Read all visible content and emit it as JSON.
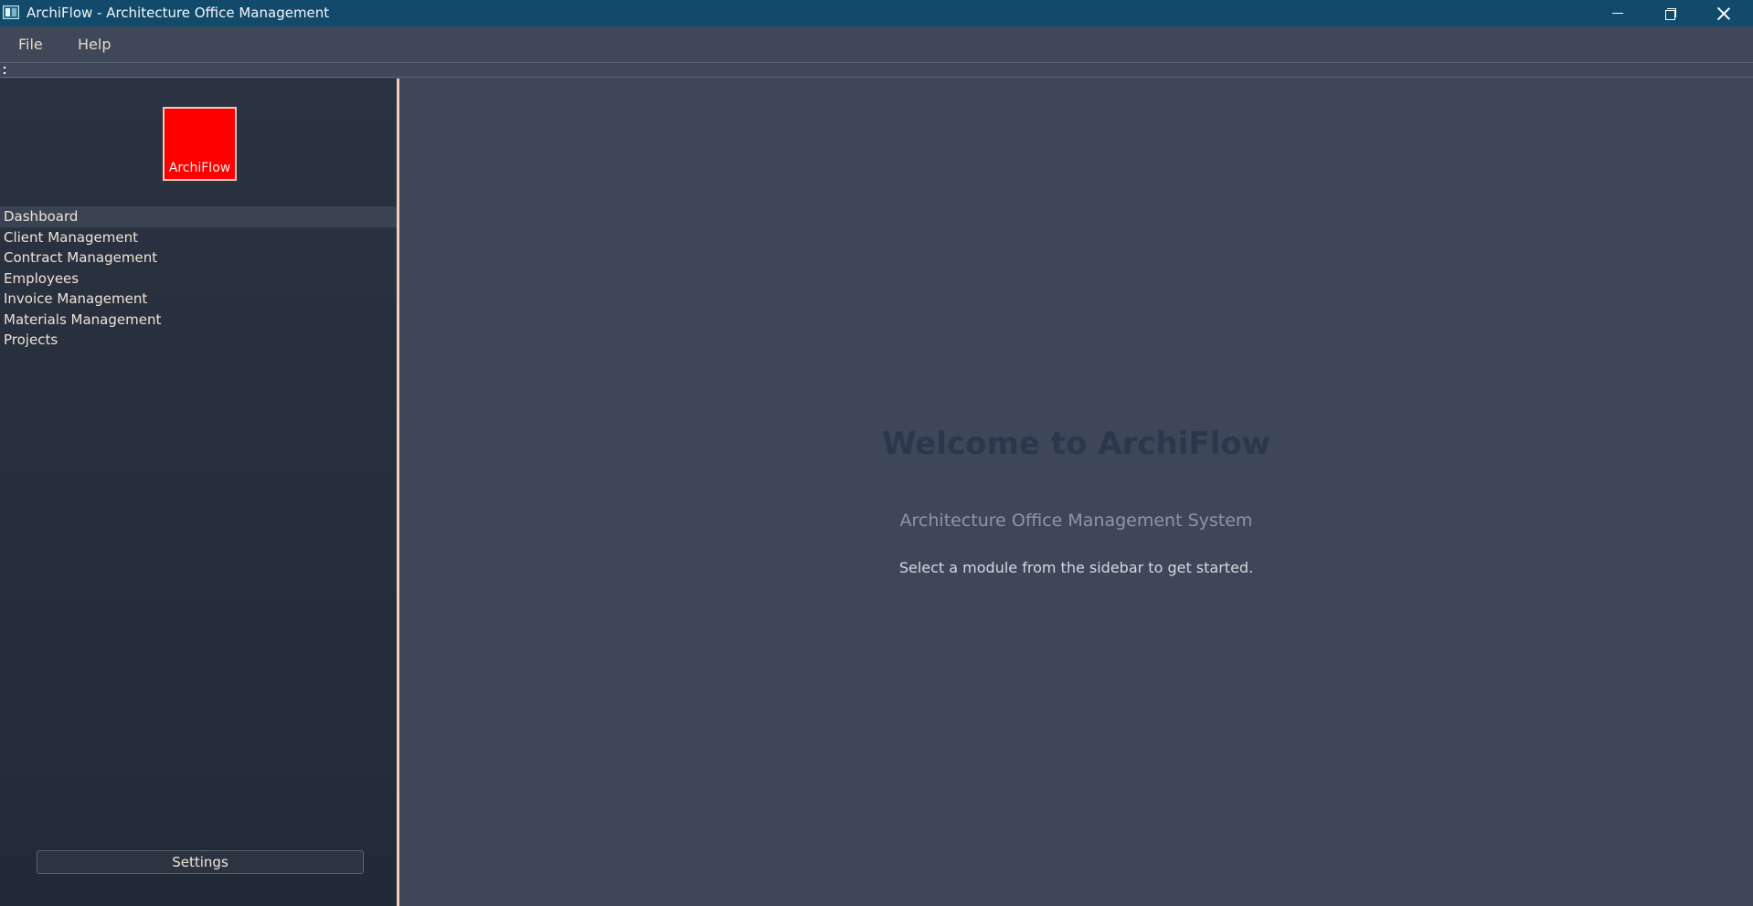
{
  "window": {
    "title": "ArchiFlow - Architecture Office Management",
    "icon": "app-window-icon"
  },
  "menu": {
    "file": "File",
    "help": "Help"
  },
  "sidebar": {
    "logo_text": "ArchiFlow",
    "logo_color": "#ff0000",
    "items": [
      {
        "label": "Dashboard",
        "selected": true
      },
      {
        "label": "Client Management",
        "selected": false
      },
      {
        "label": "Contract Management",
        "selected": false
      },
      {
        "label": "Employees",
        "selected": false
      },
      {
        "label": "Invoice Management",
        "selected": false
      },
      {
        "label": "Materials Management",
        "selected": false
      },
      {
        "label": "Projects",
        "selected": false
      }
    ],
    "settings_label": "Settings"
  },
  "main": {
    "welcome_title": "Welcome to ArchiFlow",
    "subtitle": "Architecture Office Management System",
    "hint": "Select a module from the sidebar to get started."
  },
  "colors": {
    "titlebar": "#124a6b",
    "accent_splitter": "#f0d0b8",
    "main_background": "#3d4759"
  }
}
